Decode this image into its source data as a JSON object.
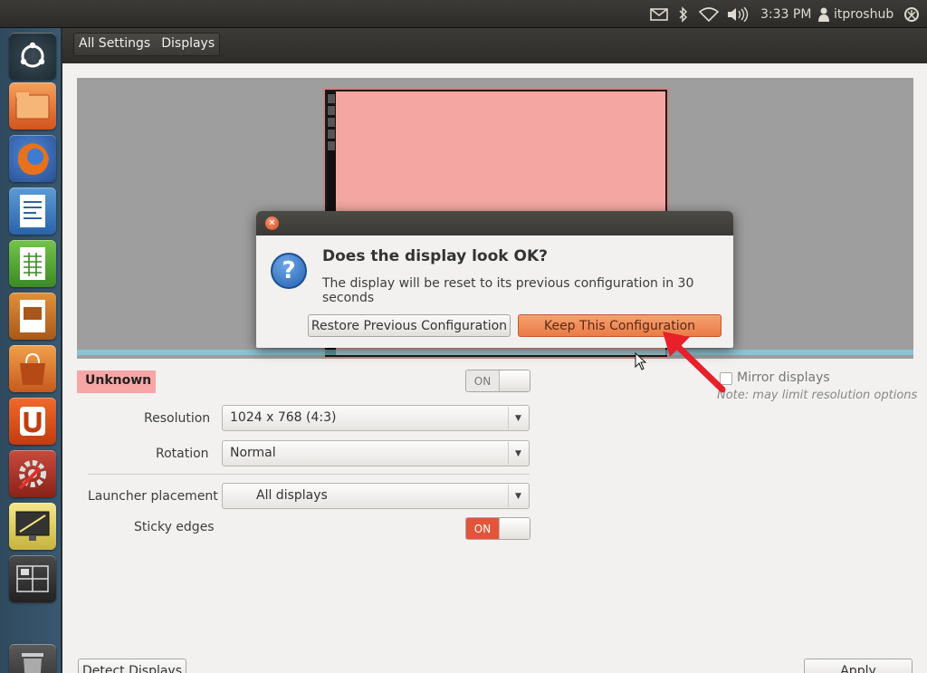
{
  "topbar": {
    "time": "3:33 PM",
    "user": "itproshub",
    "icons": [
      "mail-icon",
      "bluetooth-icon",
      "wifi-icon",
      "volume-icon",
      "user-icon",
      "power-icon"
    ]
  },
  "launcher": {
    "items": [
      "ubuntu-dash-icon",
      "files-icon",
      "firefox-icon",
      "writer-icon",
      "calc-icon",
      "impress-icon",
      "software-center-icon",
      "ubuntu-one-icon",
      "system-settings-icon",
      "display-settings-icon",
      "workspace-switcher-icon",
      "trash-icon"
    ]
  },
  "breadcrumb": {
    "all_settings": "All Settings",
    "displays": "Displays"
  },
  "display": {
    "monitor_name": "Unknown",
    "monitor_switch": "ON",
    "mirror_label": "Mirror displays",
    "mirror_note": "Note: may limit resolution options",
    "resolution_label": "Resolution",
    "resolution_value": "1024 x 768 (4:3)",
    "rotation_label": "Rotation",
    "rotation_value": "Normal",
    "launcher_placement_label": "Launcher placement",
    "launcher_placement_value": "All displays",
    "sticky_edges_label": "Sticky edges",
    "sticky_edges_switch": "ON",
    "detect_button": "Detect Displays",
    "apply_button": "Apply"
  },
  "dialog": {
    "title": "Does the display look OK?",
    "message": "The display will be reset to its previous configuration in 30 seconds",
    "restore_button": "Restore Previous Configuration",
    "keep_button": "Keep This Configuration"
  },
  "colors": {
    "accent_orange": "#dd4814",
    "monitor_fill": "#f4a7a2",
    "annotation_arrow": "#e8202a"
  }
}
